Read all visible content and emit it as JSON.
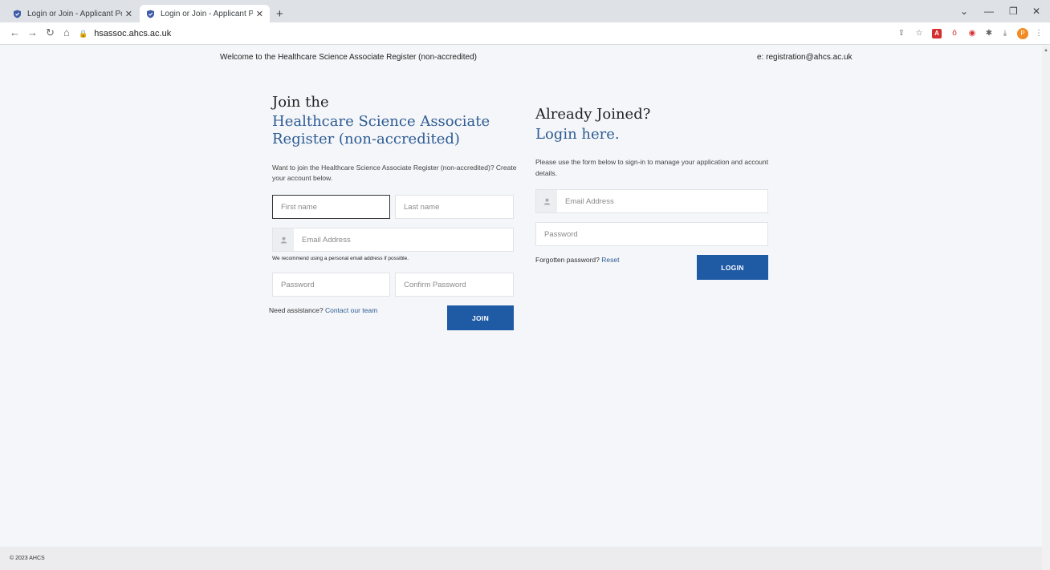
{
  "browser": {
    "tabs": [
      {
        "title": "Login or Join - Applicant Portal",
        "active": false
      },
      {
        "title": "Login or Join - Applicant Portal",
        "active": true
      }
    ],
    "url": "hsassoc.ahcs.ac.uk",
    "profile_initial": "P"
  },
  "topbar": {
    "welcome": "Welcome to the Healthcare Science Associate Register (non-accredited)",
    "email": "e: registration@ahcs.ac.uk"
  },
  "join": {
    "heading": "Join the",
    "subheading": "Healthcare Science Associate Register (non-accredited)",
    "description": "Want to join the Healthcare Science Associate Register (non-accredited)? Create your account below.",
    "first_name_placeholder": "First name",
    "last_name_placeholder": "Last name",
    "email_placeholder": "Email Address",
    "email_hint": "We recommend using a personal email address if possible.",
    "password_placeholder": "Password",
    "confirm_password_placeholder": "Confirm Password",
    "assist_text": "Need assistance?",
    "assist_link": "Contact our team",
    "join_button": "JOIN"
  },
  "login": {
    "heading": "Already Joined?",
    "subheading": "Login here.",
    "description": "Please use the form below to sign-in to manage your application and account details.",
    "email_placeholder": "Email Address",
    "password_placeholder": "Password",
    "forgot_text": "Forgotten password?",
    "reset_link": "Reset",
    "login_button": "LOGIN"
  },
  "footer": {
    "copyright": "© 2023 AHCS"
  },
  "colors": {
    "brand_blue": "#1f5aa5",
    "heading_blue": "#2d5c94",
    "page_bg": "#f5f6f9"
  }
}
